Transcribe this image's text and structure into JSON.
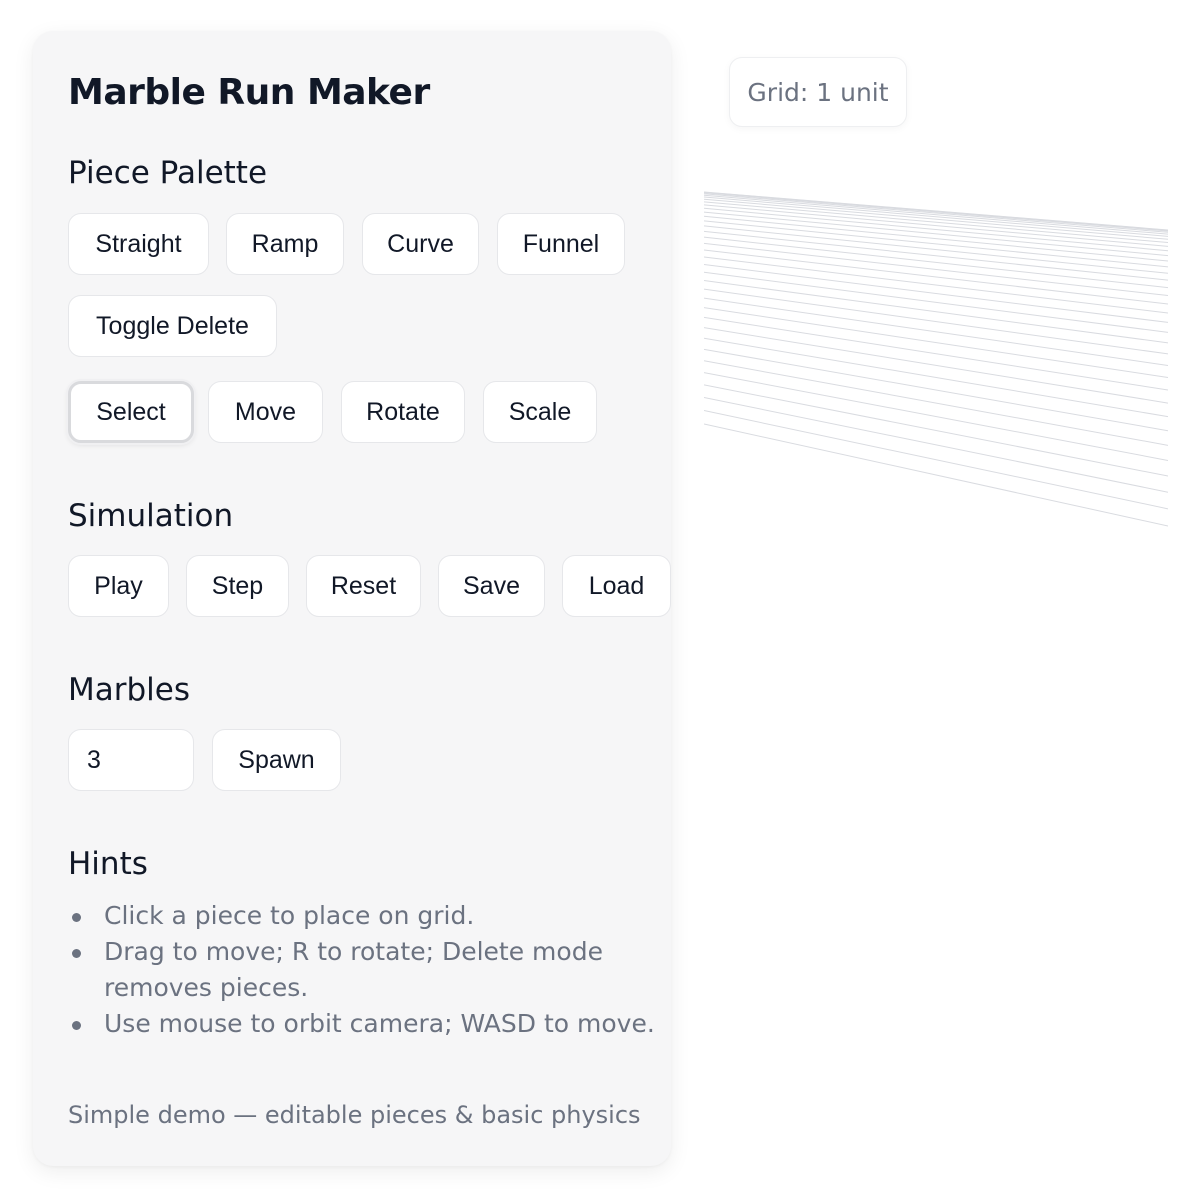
{
  "app": {
    "title": "Marble Run Maker"
  },
  "palette": {
    "heading": "Piece Palette",
    "pieces": [
      "Straight",
      "Ramp",
      "Curve",
      "Funnel"
    ],
    "toggle_delete_label": "Toggle Delete"
  },
  "tools": {
    "items": [
      "Select",
      "Move",
      "Rotate",
      "Scale"
    ],
    "active": "Select"
  },
  "simulation": {
    "heading": "Simulation",
    "buttons": [
      "Play",
      "Step",
      "Reset",
      "Save",
      "Load"
    ]
  },
  "marbles": {
    "heading": "Marbles",
    "count_value": "3",
    "spawn_label": "Spawn"
  },
  "hints": {
    "heading": "Hints",
    "items": [
      "Click a piece to place on grid.",
      "Drag to move; R to rotate; Delete mode removes pieces.",
      "Use mouse to orbit camera; WASD to move."
    ]
  },
  "footer": {
    "text": "Simple demo — editable pieces & basic physics"
  },
  "viewport": {
    "grid_label": "Grid: 1 unit",
    "grid_line_color": "#d9dbe0"
  }
}
